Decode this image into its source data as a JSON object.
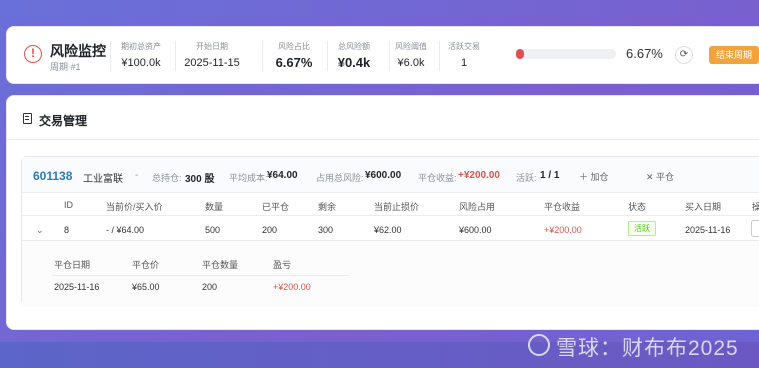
{
  "risk": {
    "title": "风险监控",
    "period": "周期 #1",
    "metrics": [
      {
        "label": "期初总资产",
        "value": "¥100.0k"
      },
      {
        "label": "开始日期",
        "value": "2025-11-15"
      },
      {
        "label": "风险占比",
        "value": "6.67%"
      },
      {
        "label": "总风险额",
        "value": "¥0.4k"
      },
      {
        "label": "风险阈值",
        "value": "¥6.0k"
      },
      {
        "label": "活跃交易",
        "value": "1"
      }
    ],
    "progress_text": "6.67%",
    "progress_fraction": 0.0667,
    "end_button": "结束周期",
    "accent_color": "#e04f55",
    "button_color": "#f2a33a"
  },
  "trade": {
    "title": "交易管理",
    "stock": {
      "code": "601138",
      "name": "工业富联",
      "dash": "-",
      "hold_label": "总持仓:",
      "hold_value": "300 股",
      "avg_cost_label": "平均成本:",
      "avg_cost_value": "¥64.00",
      "risk_label": "占用总风险:",
      "risk_value": "¥600.00",
      "profit_label": "平仓收益:",
      "profit_value": "+¥200.00",
      "active_label": "活跃:",
      "active_value": "1 / 1",
      "add_action": "＋ 加仓",
      "close_action": "✕ 平仓"
    },
    "columns": [
      "ID",
      "当前价/买入价",
      "数量",
      "已平仓",
      "剩余",
      "当前止损价",
      "风险占用",
      "平仓收益",
      "状态",
      "买入日期",
      "操"
    ],
    "rows": [
      {
        "id": "8",
        "price": "- / ¥64.00",
        "qty": "500",
        "closed": "200",
        "remain": "300",
        "stop": "¥62.00",
        "risk": "¥600.00",
        "profit": "+¥200.00",
        "status": "活跃",
        "date": "2025-11-16"
      }
    ],
    "sub_columns": [
      "平仓日期",
      "平仓价",
      "平仓数量",
      "盈亏"
    ],
    "sub_rows": [
      {
        "date": "2025-11-16",
        "price": "¥65.00",
        "qty": "200",
        "pnl": "+¥200.00"
      }
    ]
  },
  "watermark": "雪球：财布布2025"
}
